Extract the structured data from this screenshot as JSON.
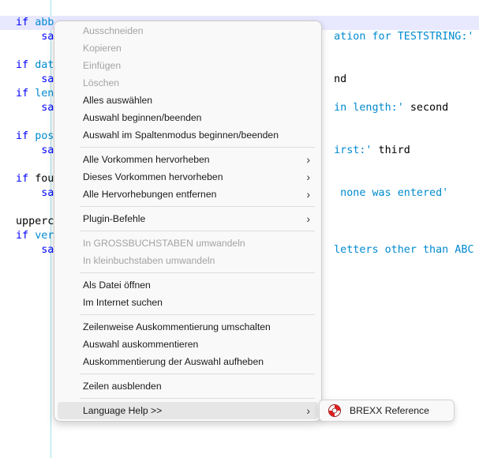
{
  "editor": {
    "lines": [
      {
        "segments": [
          [
            "kw",
            "if "
          ],
          [
            "str",
            "abb"
          ]
        ]
      },
      {
        "segments": [
          [
            "kw",
            "    sa"
          ],
          [
            "str",
            "                                            ation for TESTSTRING:'"
          ]
        ]
      },
      {
        "segments": []
      },
      {
        "segments": [
          [
            "kw",
            "if "
          ],
          [
            "str",
            "dat"
          ]
        ]
      },
      {
        "segments": [
          [
            "kw",
            "    sa"
          ],
          [
            "fn",
            "                                            nd"
          ]
        ]
      },
      {
        "segments": [
          [
            "kw",
            "if "
          ],
          [
            "str",
            "len"
          ]
        ]
      },
      {
        "segments": [
          [
            "kw",
            "    sa"
          ],
          [
            "str",
            "                                            in length:'"
          ],
          [
            "fn",
            " second"
          ]
        ]
      },
      {
        "segments": []
      },
      {
        "segments": [
          [
            "kw",
            "if "
          ],
          [
            "str",
            "pos"
          ]
        ]
      },
      {
        "segments": [
          [
            "kw",
            "    sa"
          ],
          [
            "str",
            "                                            irst:'"
          ],
          [
            "fn",
            " third"
          ]
        ]
      },
      {
        "segments": []
      },
      {
        "segments": [
          [
            "kw",
            "if "
          ],
          [
            "fn",
            "fou"
          ]
        ]
      },
      {
        "segments": [
          [
            "kw",
            "    sa"
          ],
          [
            "str",
            "                                             none was entered'"
          ]
        ]
      },
      {
        "segments": []
      },
      {
        "segments": [
          [
            "fn",
            "upperc"
          ]
        ]
      },
      {
        "segments": [
          [
            "kw",
            "if "
          ],
          [
            "str",
            "ver"
          ]
        ]
      },
      {
        "segments": [
          [
            "kw",
            "    sa"
          ],
          [
            "str",
            "                                            letters other than ABC"
          ]
        ]
      }
    ]
  },
  "context_menu": {
    "items": [
      {
        "label": "Ausschneiden",
        "disabled": true
      },
      {
        "label": "Kopieren",
        "disabled": true
      },
      {
        "label": "Einfügen",
        "disabled": true
      },
      {
        "label": "Löschen",
        "disabled": true
      },
      {
        "label": "Alles auswählen",
        "disabled": false
      },
      {
        "label": "Auswahl beginnen/beenden",
        "disabled": false
      },
      {
        "label": "Auswahl im Spaltenmodus beginnen/beenden",
        "disabled": false
      },
      {
        "label": "Alle Vorkommen hervorheben",
        "disabled": false,
        "submenu": true
      },
      {
        "label": "Dieses Vorkommen hervorheben",
        "disabled": false,
        "submenu": true
      },
      {
        "label": "Alle Hervorhebungen entfernen",
        "disabled": false,
        "submenu": true
      },
      {
        "label": "Plugin-Befehle",
        "disabled": false,
        "submenu": true
      },
      {
        "label": "In GROSSBUCHSTABEN umwandeln",
        "disabled": true
      },
      {
        "label": "In kleinbuchstaben umwandeln",
        "disabled": true
      },
      {
        "label": "Als Datei öffnen",
        "disabled": false
      },
      {
        "label": "Im Internet suchen",
        "disabled": false
      },
      {
        "label": "Zeilenweise Auskommentierung umschalten",
        "disabled": false
      },
      {
        "label": "Auswahl auskommentieren",
        "disabled": false
      },
      {
        "label": "Auskommentierung der Auswahl aufheben",
        "disabled": false
      },
      {
        "label": "Zeilen ausblenden",
        "disabled": false
      },
      {
        "label": "Language Help >>",
        "disabled": false,
        "submenu": true,
        "hover": true
      }
    ],
    "submenu_arrow": "›"
  },
  "submenu": {
    "items": [
      {
        "label": "BREXX Reference",
        "icon": "lifebuoy-icon"
      }
    ]
  },
  "colors": {
    "keyword": "#0000ff",
    "string": "#008ad0",
    "current_line": "#e8e8ff",
    "indent_guide": "#9fe0e6",
    "menu_bg": "#f9f9f9",
    "disabled_text": "#a3a3a3"
  }
}
